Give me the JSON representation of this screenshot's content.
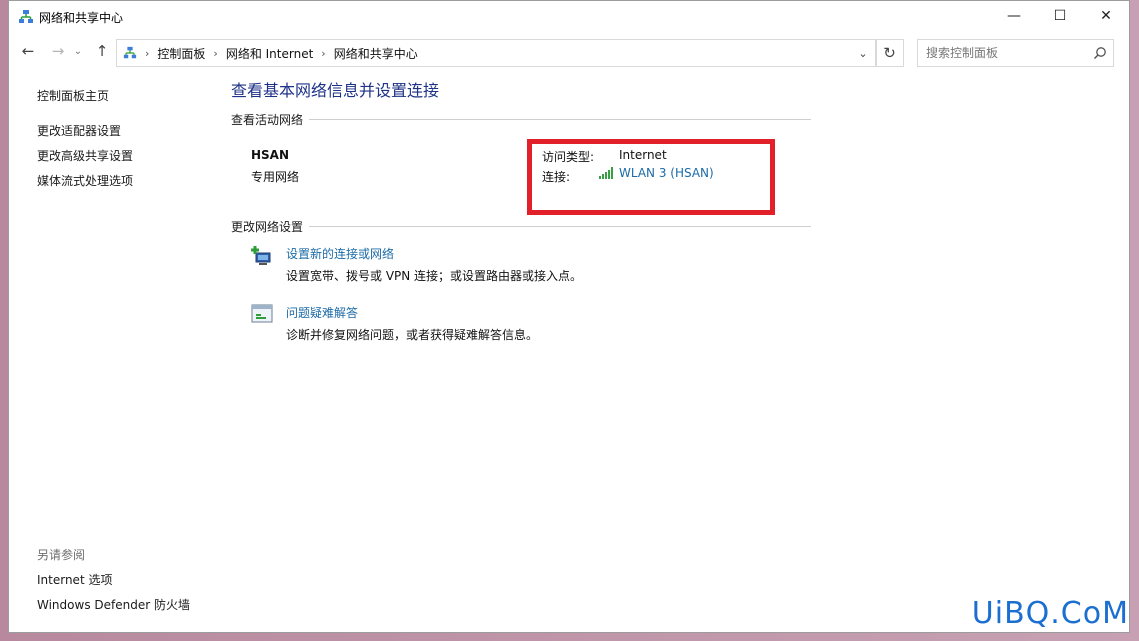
{
  "window": {
    "title": "网络和共享中心",
    "minimize_symbol": "—",
    "maximize_symbol": "☐",
    "close_symbol": "✕"
  },
  "nav": {
    "back_symbol": "←",
    "forward_symbol": "→",
    "recent_symbol": "⌄",
    "up_symbol": "↑",
    "refresh_symbol": "↻",
    "dropdown_symbol": "⌄"
  },
  "address": {
    "crumbs": [
      "控制面板",
      "网络和 Internet",
      "网络和共享中心"
    ],
    "separator": "›"
  },
  "search": {
    "placeholder": "搜索控制面板"
  },
  "sidebar": {
    "home": "控制面板主页",
    "items": [
      {
        "label": "更改适配器设置"
      },
      {
        "label": "更改高级共享设置"
      },
      {
        "label": "媒体流式处理选项"
      }
    ],
    "see_also": {
      "title": "另请参阅",
      "items": [
        {
          "label": "Internet 选项"
        },
        {
          "label": "Windows Defender 防火墙"
        }
      ]
    }
  },
  "main": {
    "title": "查看基本网络信息并设置连接",
    "active_networks_heading": "查看活动网络",
    "network": {
      "name": "HSAN",
      "type": "专用网络",
      "access_type_label": "访问类型:",
      "access_type_value": "Internet",
      "connection_label": "连接:",
      "connection_value": "WLAN 3 (HSAN)"
    },
    "change_settings_heading": "更改网络设置",
    "tasks": [
      {
        "link": "设置新的连接或网络",
        "desc": "设置宽带、拨号或 VPN 连接；或设置路由器或接入点。",
        "icon": "new-connection-icon"
      },
      {
        "link": "问题疑难解答",
        "desc": "诊断并修复网络问题，或者获得疑难解答信息。",
        "icon": "troubleshoot-icon"
      }
    ]
  },
  "colors": {
    "highlight_border": "#e2202a",
    "link": "#1b6ba8",
    "title": "#1e3287"
  },
  "watermark": "UiBQ.CoM"
}
